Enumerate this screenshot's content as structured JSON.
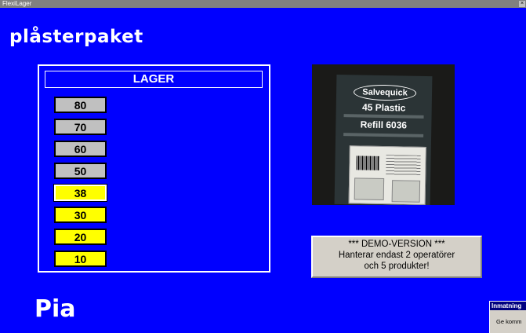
{
  "window": {
    "title": "FlexiLager"
  },
  "product": {
    "name": "plåsterpaket"
  },
  "operator": {
    "name": "Pia"
  },
  "lager": {
    "header": "LAGER",
    "levels": [
      {
        "value": "80",
        "state": "empty"
      },
      {
        "value": "70",
        "state": "empty"
      },
      {
        "value": "60",
        "state": "empty"
      },
      {
        "value": "50",
        "state": "empty"
      },
      {
        "value": "38",
        "state": "current"
      },
      {
        "value": "30",
        "state": "filled"
      },
      {
        "value": "20",
        "state": "filled"
      },
      {
        "value": "10",
        "state": "filled"
      }
    ]
  },
  "photo": {
    "brand": "Salvequick",
    "line1": "45 Plastic",
    "line2": "Refill 6036"
  },
  "demo": {
    "line1": "*** DEMO-VERSION ***",
    "line2": "Hanterar endast 2 operatörer",
    "line3": "och 5 produkter!"
  },
  "dialog": {
    "title": "Inmatning",
    "prompt": "Ge komm"
  },
  "colors": {
    "background": "#0000ff",
    "filled": "#ffff00",
    "empty": "#c0c0c0"
  }
}
